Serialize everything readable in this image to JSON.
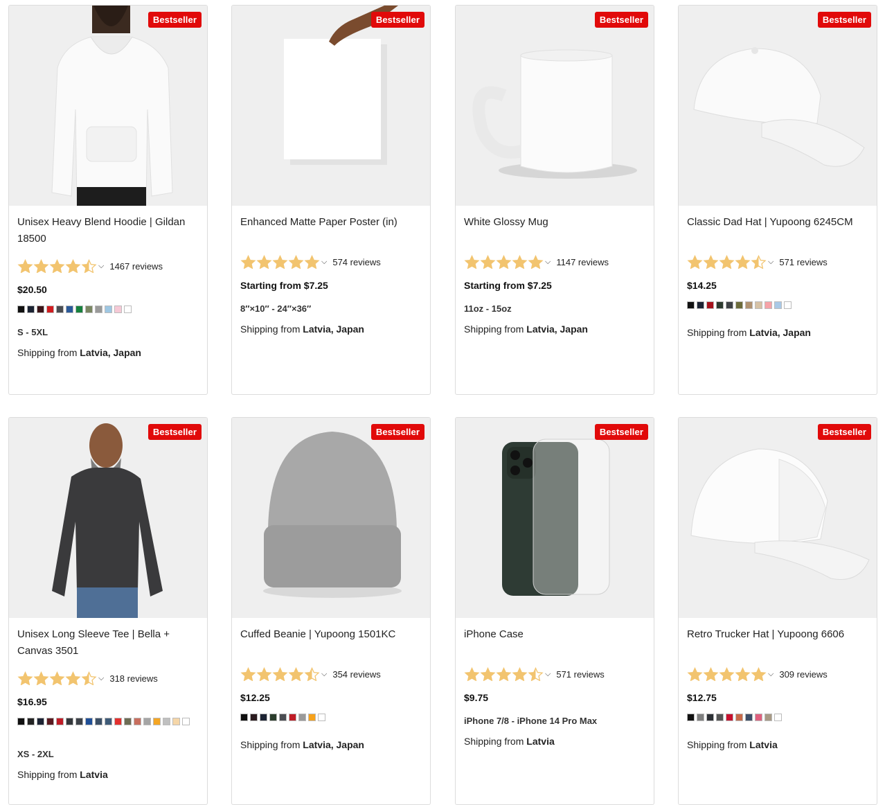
{
  "products": [
    {
      "badge": "Bestseller",
      "title": "Unisex Heavy Blend Hoodie | Gildan 18500",
      "rating": 4.5,
      "reviews": "1467 reviews",
      "price": "$20.50",
      "swatches": [
        "#111111",
        "#1c2333",
        "#3b1418",
        "#d01c1f",
        "#4a4d52",
        "#2b5a9a",
        "#17813d",
        "#7a8763",
        "#9a9a9a",
        "#9ec7e3",
        "#f6c9d6",
        "#ffffff"
      ],
      "sizes": "S - 5XL",
      "ship_label": "Shipping from",
      "ship_from": "Latvia, Japan"
    },
    {
      "badge": "Bestseller",
      "title": "Enhanced Matte Paper Poster (in)",
      "rating": 5,
      "reviews": "574 reviews",
      "price": "Starting from $7.25",
      "swatches": [],
      "sizes": "8″×10″ - 24″×36″",
      "ship_label": "Shipping from",
      "ship_from": "Latvia, Japan"
    },
    {
      "badge": "Bestseller",
      "title": "White Glossy Mug",
      "rating": 5,
      "reviews": "1147 reviews",
      "price": "Starting from $7.25",
      "swatches": [],
      "sizes": "11oz - 15oz",
      "ship_label": "Shipping from",
      "ship_from": "Latvia, Japan"
    },
    {
      "badge": "Bestseller",
      "title": "Classic Dad Hat | Yupoong 6245CM",
      "rating": 4.5,
      "reviews": "571 reviews",
      "price": "$14.25",
      "swatches": [
        "#111111",
        "#1c2333",
        "#a5121c",
        "#2d3a2f",
        "#3e4145",
        "#6b6b3a",
        "#b09272",
        "#d6c2a6",
        "#f6a3a8",
        "#a9c9e6",
        "#ffffff"
      ],
      "sizes": "",
      "ship_label": "Shipping from",
      "ship_from": "Latvia, Japan"
    },
    {
      "badge": "Bestseller",
      "title": "Unisex Long Sleeve Tee | Bella + Canvas 3501",
      "rating": 4.5,
      "reviews": "318 reviews",
      "price": "$16.95",
      "swatches": [
        "#111111",
        "#232323",
        "#1c2333",
        "#5a1a20",
        "#c01c26",
        "#33373b",
        "#3d4249",
        "#1f4f97",
        "#3b4f66",
        "#3f5b78",
        "#e3302e",
        "#6d6d55",
        "#c86e5e",
        "#a5a5a5",
        "#f5a623",
        "#c0c0c0",
        "#f5d6a8",
        "#ffffff"
      ],
      "sizes": "XS - 2XL",
      "ship_label": "Shipping from",
      "ship_from": "Latvia"
    },
    {
      "badge": "Bestseller",
      "title": "Cuffed Beanie | Yupoong 1501KC",
      "rating": 4.5,
      "reviews": "354 reviews",
      "price": "$12.25",
      "swatches": [
        "#111111",
        "#2b1b1f",
        "#1c2333",
        "#2b3d2c",
        "#4a4d52",
        "#c01c26",
        "#9a9a9a",
        "#f7a21b",
        "#ffffff"
      ],
      "sizes": "",
      "ship_label": "Shipping from",
      "ship_from": "Latvia, Japan"
    },
    {
      "badge": "Bestseller",
      "title": "iPhone Case",
      "rating": 4.5,
      "reviews": "571 reviews",
      "price": "$9.75",
      "swatches": [],
      "sizes": "iPhone 7/8 - iPhone 14 Pro Max",
      "ship_label": "Shipping from",
      "ship_from": "Latvia"
    },
    {
      "badge": "Bestseller",
      "title": "Retro Trucker Hat | Yupoong 6606",
      "rating": 5,
      "reviews": "309 reviews",
      "price": "$12.75",
      "swatches": [
        "#111111",
        "#7f7f7f",
        "#2d3035",
        "#555555",
        "#c8102e",
        "#c86a4a",
        "#3d4e68",
        "#e0607e",
        "#a89a85",
        "#ffffff"
      ],
      "sizes": "",
      "ship_label": "Shipping from",
      "ship_from": "Latvia"
    }
  ]
}
